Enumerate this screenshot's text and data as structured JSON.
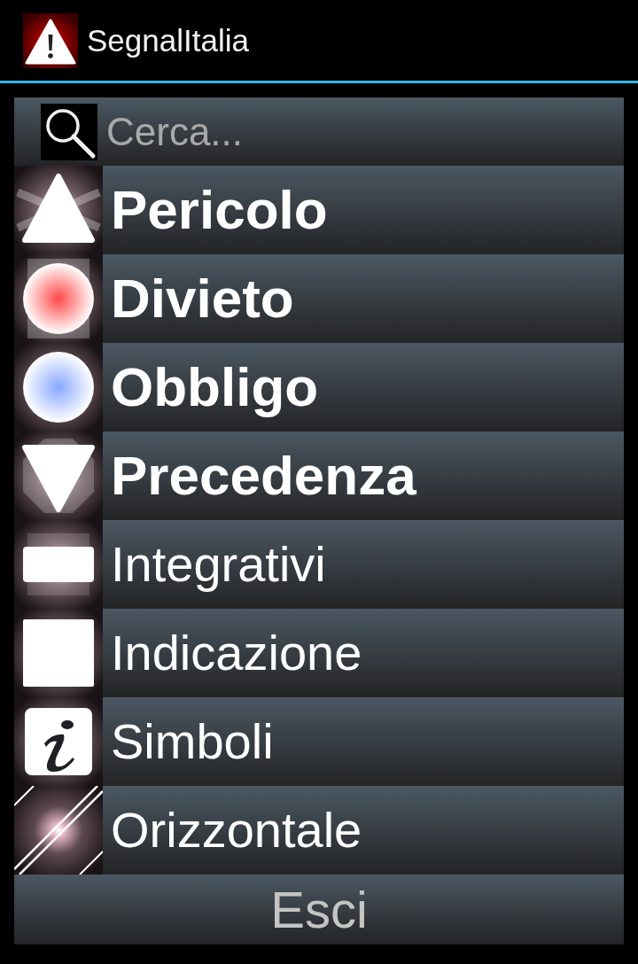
{
  "app_bar": {
    "title": "SegnalItalia"
  },
  "search": {
    "placeholder": "Cerca..."
  },
  "categories": [
    {
      "label": "Pericolo",
      "emphasized": true
    },
    {
      "label": "Divieto",
      "emphasized": true
    },
    {
      "label": "Obbligo",
      "emphasized": true
    },
    {
      "label": "Precedenza",
      "emphasized": true
    },
    {
      "label": "Integrativi",
      "emphasized": false
    },
    {
      "label": "Indicazione",
      "emphasized": false
    },
    {
      "label": "Simboli",
      "emphasized": false
    },
    {
      "label": "Orizzontale",
      "emphasized": false
    }
  ],
  "exit_button": {
    "label": "Esci"
  }
}
